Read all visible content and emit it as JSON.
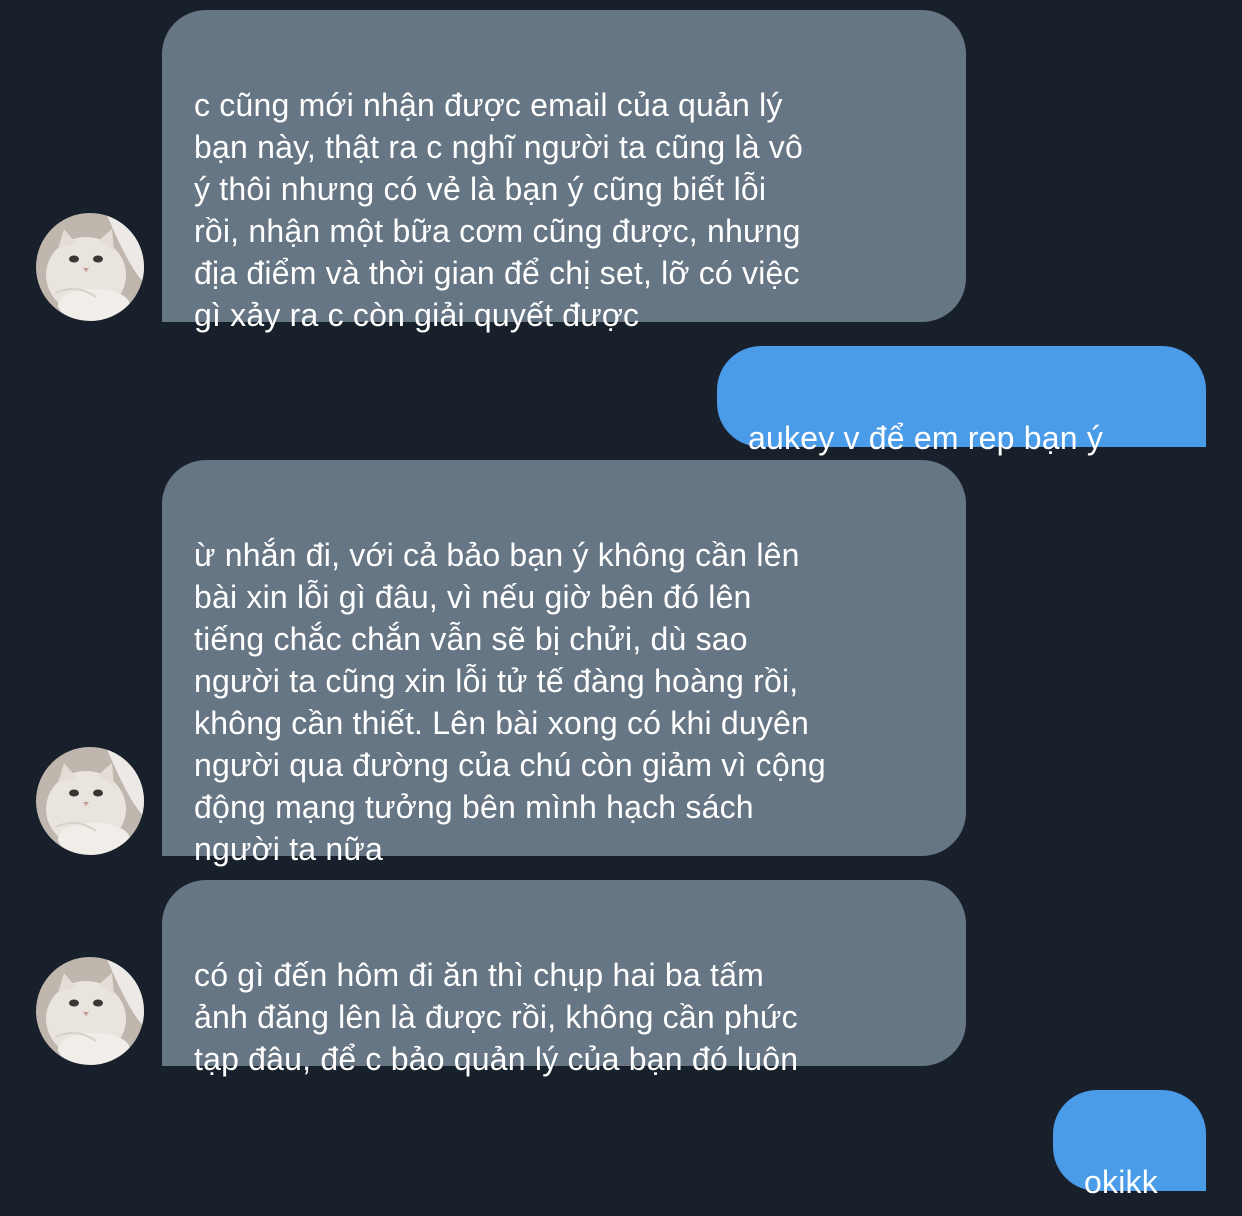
{
  "messages": [
    {
      "direction": "incoming",
      "text": "c cũng mới nhận được email của quản lý\nbạn này, thật ra c nghĩ người ta cũng là vô\ný thôi nhưng có vẻ là bạn ý cũng biết lỗi\nrồi, nhận một bữa cơm cũng được, nhưng\nđịa điểm và thời gian để chị set, lỡ có việc\ngì xảy ra c còn giải quyết được",
      "avatar": "cat-avatar-icon"
    },
    {
      "direction": "outgoing",
      "text": "aukey v để em rep bạn ý"
    },
    {
      "direction": "incoming",
      "text": "ừ nhắn đi, với cả bảo bạn ý không cần lên\nbài xin lỗi gì đâu, vì nếu giờ bên đó lên\ntiếng chắc chắn vẫn sẽ bị chửi, dù sao\nngười ta cũng xin lỗi tử tế đàng hoàng rồi,\nkhông cần thiết. Lên bài xong có khi duyên\nngười qua đường của chú còn giảm vì cộng\nđộng mạng tưởng bên mình hạch sách\nngười ta nữa",
      "avatar": "cat-avatar-icon"
    },
    {
      "direction": "incoming",
      "text": "có gì đến hôm đi ăn thì chụp hai ba tấm\nảnh đăng lên là được rồi, không cần phức\ntạp đâu, để c bảo quản lý của bạn đó luôn",
      "avatar": "cat-avatar-icon"
    },
    {
      "direction": "outgoing",
      "text": "okikk"
    }
  ],
  "colors": {
    "background": "#18202b",
    "incoming_bubble": "#677684",
    "outgoing_bubble": "#4a9be8",
    "text": "#ffffff"
  }
}
